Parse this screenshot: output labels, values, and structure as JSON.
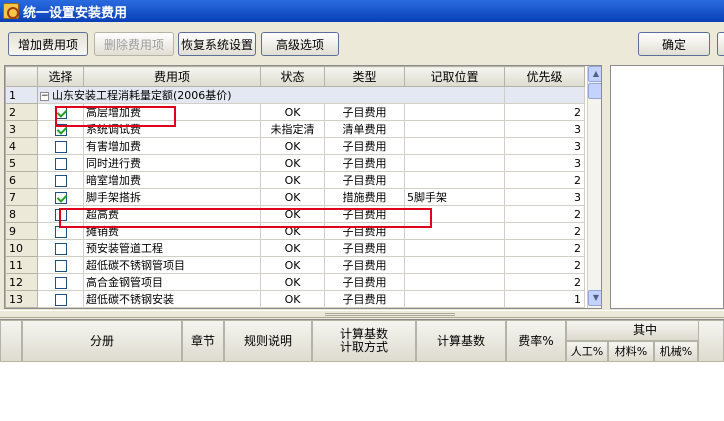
{
  "window": {
    "title": "统一设置安装费用"
  },
  "toolbar": {
    "add_label": "增加费用项",
    "delete_label": "删除费用项",
    "restore_label": "恢复系统设置",
    "advanced_label": "高级选项",
    "ok_label": "确定"
  },
  "grid": {
    "headers": {
      "select": "选择",
      "item": "费用项",
      "status": "状态",
      "type": "类型",
      "position": "记取位置",
      "priority": "优先级"
    },
    "group": {
      "num": "1",
      "label": "山东安装工程消耗量定额(2006基价)"
    },
    "rows": [
      {
        "num": "2",
        "checked": true,
        "name": "高层增加费",
        "status": "OK",
        "type": "子目费用",
        "position": "",
        "priority": "2"
      },
      {
        "num": "3",
        "checked": true,
        "name": "系统调试费",
        "status": "未指定清",
        "type": "清单费用",
        "position": "",
        "priority": "3"
      },
      {
        "num": "4",
        "checked": false,
        "name": "有害增加费",
        "status": "OK",
        "type": "子目费用",
        "position": "",
        "priority": "3"
      },
      {
        "num": "5",
        "checked": false,
        "name": "同时进行费",
        "status": "OK",
        "type": "子目费用",
        "position": "",
        "priority": "3"
      },
      {
        "num": "6",
        "checked": false,
        "name": "暗室增加费",
        "status": "OK",
        "type": "子目费用",
        "position": "",
        "priority": "2"
      },
      {
        "num": "7",
        "checked": true,
        "name": "脚手架搭拆",
        "status": "OK",
        "type": "措施费用",
        "position": "5脚手架",
        "priority": "3"
      },
      {
        "num": "8",
        "checked": false,
        "name": "超高费",
        "status": "OK",
        "type": "子目费用",
        "position": "",
        "priority": "2"
      },
      {
        "num": "9",
        "checked": false,
        "name": "摊销费",
        "status": "OK",
        "type": "子目费用",
        "position": "",
        "priority": "2"
      },
      {
        "num": "10",
        "checked": false,
        "name": "预安装管道工程",
        "status": "OK",
        "type": "子目费用",
        "position": "",
        "priority": "2"
      },
      {
        "num": "11",
        "checked": false,
        "name": "超低碳不锈钢管项目",
        "status": "OK",
        "type": "子目费用",
        "position": "",
        "priority": "2"
      },
      {
        "num": "12",
        "checked": false,
        "name": "高合金钢管项目",
        "status": "OK",
        "type": "子目费用",
        "position": "",
        "priority": "2"
      },
      {
        "num": "13",
        "checked": false,
        "name": "超低碳不锈钢安装",
        "status": "OK",
        "type": "子目费用",
        "position": "",
        "priority": "1"
      }
    ]
  },
  "bottom_grid": {
    "headers": {
      "part": "分册",
      "chapter": "章节",
      "rule": "规则说明",
      "calc_base_method_line1": "计算基数",
      "calc_base_method_line2": "计取方式",
      "calc_base": "计算基数",
      "rate": "费率%",
      "among": "其中",
      "labor": "人工%",
      "material": "材料%",
      "machine": "机械%"
    }
  },
  "colors": {
    "title_bar": "#0a3fb5",
    "highlight": "#e0001b",
    "group_row": "#e4e8f2"
  }
}
